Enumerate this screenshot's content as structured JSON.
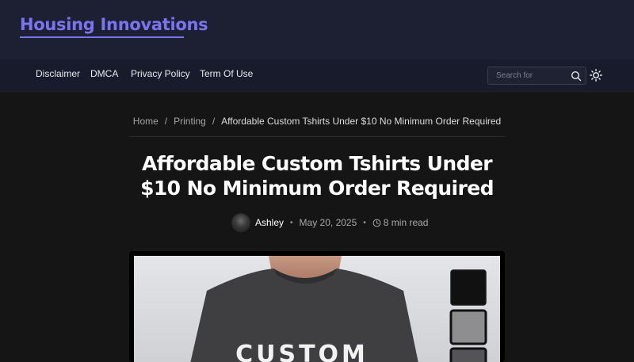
{
  "site": {
    "title": "Housing Innovations"
  },
  "nav": {
    "items": [
      {
        "label": "Disclaimer"
      },
      {
        "label": "DMCA"
      },
      {
        "label": "Privacy Policy"
      },
      {
        "label": "Term Of Use"
      }
    ],
    "search_placeholder": "Search for",
    "icons": {
      "search": "search-icon",
      "theme": "sun-icon"
    }
  },
  "breadcrumb": {
    "home": "Home",
    "category": "Printing",
    "current": "Affordable Custom Tshirts Under $10 No Minimum Order Required",
    "separator": "/"
  },
  "article": {
    "title": "Affordable Custom Tshirts Under $10 No Minimum Order Required",
    "author": "Ashley",
    "date": "May 20, 2025",
    "read_time": "8 min read",
    "meta_separator": "•"
  },
  "hero": {
    "shirt_text": "CUSTOM",
    "colors": {
      "shirt": "#3f3f41",
      "background": "#dcdde0",
      "swatch_dark": "#111111",
      "swatch_grey": "#8e8e90",
      "swatch_charcoal": "#545458"
    }
  },
  "colors": {
    "accent": "#7b74f0",
    "header_bg": "#1d2033",
    "page_bg": "#151515"
  }
}
